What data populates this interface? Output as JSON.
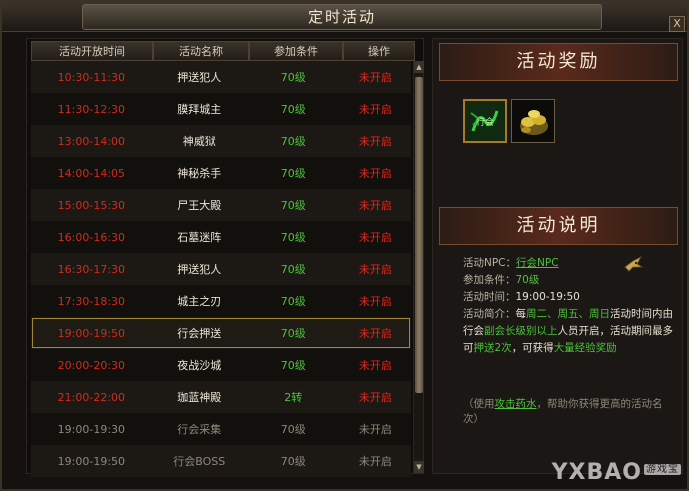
{
  "window": {
    "title": "定时活动",
    "close_label": "X"
  },
  "table": {
    "headers": [
      "活动开放时间",
      "活动名称",
      "参加条件",
      "操作"
    ],
    "rows": [
      {
        "time": "10:30-11:30",
        "name": "押送犯人",
        "level": "70级",
        "action": "未开启"
      },
      {
        "time": "11:30-12:30",
        "name": "膜拜城主",
        "level": "70级",
        "action": "未开启"
      },
      {
        "time": "13:00-14:00",
        "name": "神威狱",
        "level": "70级",
        "action": "未开启"
      },
      {
        "time": "14:00-14:05",
        "name": "神秘杀手",
        "level": "70级",
        "action": "未开启"
      },
      {
        "time": "15:00-15:30",
        "name": "尸王大殿",
        "level": "70级",
        "action": "未开启"
      },
      {
        "time": "16:00-16:30",
        "name": "石墓迷阵",
        "level": "70级",
        "action": "未开启"
      },
      {
        "time": "16:30-17:30",
        "name": "押送犯人",
        "level": "70级",
        "action": "未开启"
      },
      {
        "time": "17:30-18:30",
        "name": "城主之刃",
        "level": "70级",
        "action": "未开启"
      },
      {
        "time": "19:00-19:50",
        "name": "行会押送",
        "level": "70级",
        "action": "未开启"
      },
      {
        "time": "20:00-20:30",
        "name": "夜战沙城",
        "level": "70级",
        "action": "未开启"
      },
      {
        "time": "21:00-22:00",
        "name": "珈蓝神殿",
        "level": "2转",
        "action": "未开启"
      },
      {
        "time": "19:00-19:30",
        "name": "行会采集",
        "level": "70级",
        "action": "未开启"
      },
      {
        "time": "19:00-19:50",
        "name": "行会BOSS",
        "level": "70级",
        "action": "未开启"
      }
    ]
  },
  "rewards": {
    "title": "活动奖励",
    "items": [
      {
        "icon": "guild-contribution-icon",
        "label": "行会"
      },
      {
        "icon": "gold-ingots-icon"
      }
    ]
  },
  "description": {
    "title": "活动说明",
    "npc_label": "活动NPC：",
    "npc_value": "行会NPC",
    "condition_label": "参加条件：",
    "condition_value": "70级",
    "time_label": "活动时间：",
    "time_value": "19:00-19:50",
    "intro_label": "活动简介：",
    "intro_1": "每",
    "intro_2": "周二、周五、周日",
    "intro_3": "活动时间内由行会",
    "intro_4": "副会长级别以上",
    "intro_5": "人员开启，活动期间最多可",
    "intro_6": "押送2次",
    "intro_7": "，可获得",
    "intro_8": "大量经验奖励",
    "footnote_1": "（使用",
    "footnote_link": "攻击药水",
    "footnote_2": "，帮助你获得更高的活动名次）"
  },
  "watermark": {
    "text": "YXBAO",
    "badge": "游戏宝"
  },
  "colors": {
    "time_red": "#d12a1e",
    "level_green": "#4cc23c",
    "action_red": "#e0261c",
    "selected_gold": "#a08638"
  }
}
